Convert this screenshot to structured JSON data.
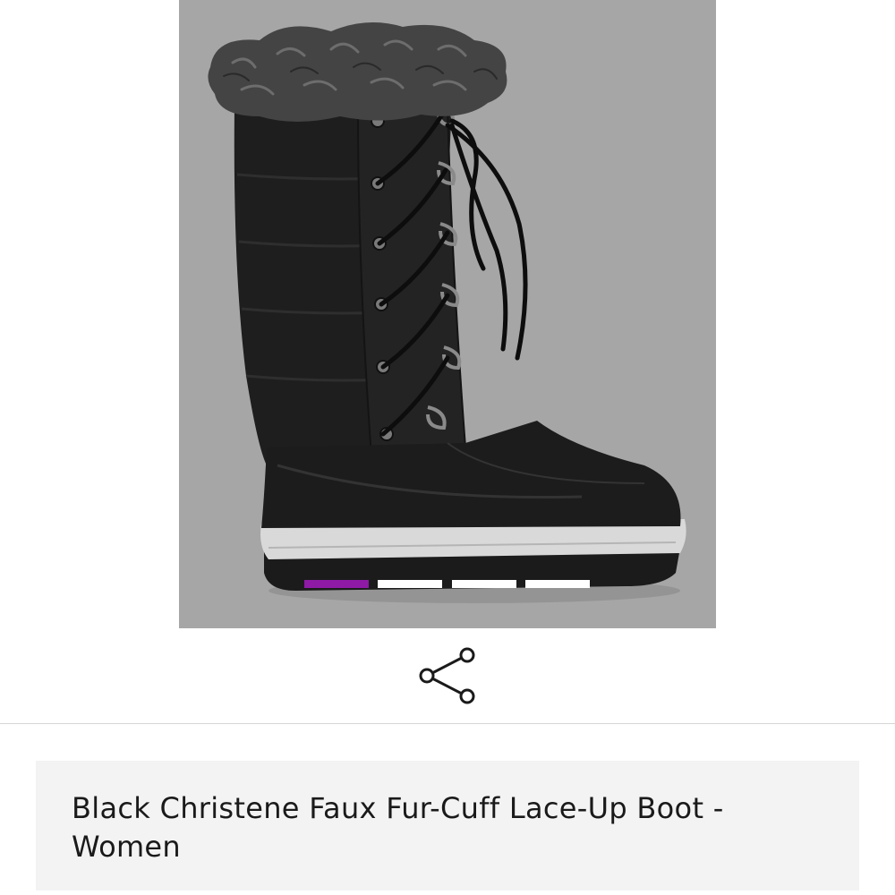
{
  "product": {
    "title": "Black Christene Faux Fur-Cuff Lace-Up Boot - Women",
    "image_alt": "Black Christene Faux Fur-Cuff Lace-Up Boot"
  },
  "gallery": {
    "total_images": 4,
    "active_index": 0,
    "active_color": "#8e1aa6",
    "inactive_color": "#ffffff",
    "background_color": "#a6a6a6"
  },
  "actions": {
    "share_icon": "share-icon"
  }
}
